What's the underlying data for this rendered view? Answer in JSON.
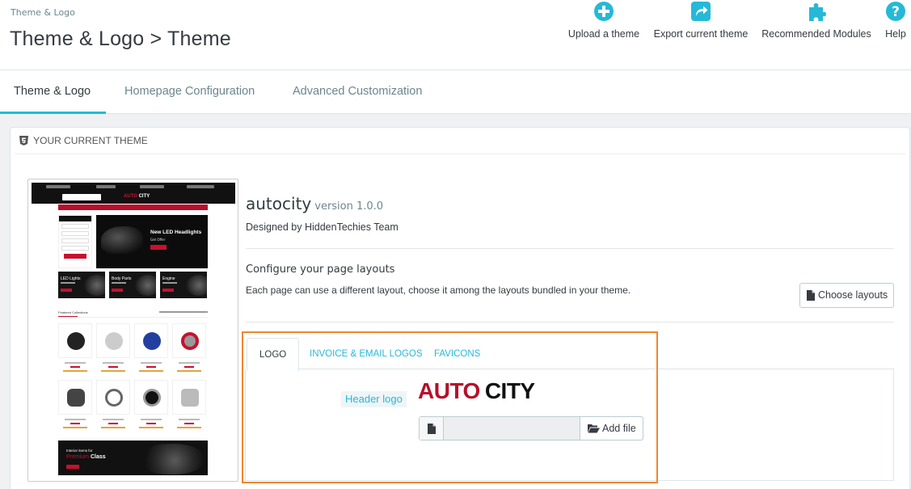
{
  "header": {
    "breadcrumb": "Theme & Logo",
    "title": "Theme & Logo > Theme",
    "toolbar": [
      {
        "label": "Upload a theme",
        "icon": "plus-circle-icon"
      },
      {
        "label": "Export current theme",
        "icon": "share-icon"
      },
      {
        "label": "Recommended Modules",
        "icon": "puzzle-icon"
      },
      {
        "label": "Help",
        "icon": "help-icon"
      }
    ]
  },
  "tabs": [
    {
      "label": "Theme & Logo",
      "active": true
    },
    {
      "label": "Homepage Configuration",
      "active": false
    },
    {
      "label": "Advanced Customization",
      "active": false
    }
  ],
  "panel": {
    "heading": "Your current theme",
    "preview": {
      "logo_a": "AUTO",
      "logo_b": "CITY",
      "banner_title": "New LED Headlights",
      "categories": [
        "LED Lights",
        "Body Parts",
        "Engine"
      ],
      "featured": "Featured Collections",
      "bottom_line1": "Interior items for",
      "bottom_line2a": "Premium",
      "bottom_line2b": "Class"
    },
    "theme": {
      "name": "autocity",
      "version": "version 1.0.0",
      "author": "Designed by HiddenTechies Team"
    },
    "layouts": {
      "title": "Configure your page layouts",
      "description": "Each page can use a different layout, choose it among the layouts bundled in your theme.",
      "button": "Choose layouts"
    },
    "logo_tabs": [
      {
        "label": "Logo",
        "active": true
      },
      {
        "label": "Invoice & Email Logos",
        "active": false
      },
      {
        "label": "Favicons",
        "active": false
      }
    ],
    "header_logo": {
      "label": "Header logo",
      "brand_a": "AUTO",
      "brand_b": "CITY",
      "file_value": "",
      "add_button": "Add file"
    }
  },
  "colors": {
    "accent": "#25b9d7",
    "brand_red": "#b5102a",
    "highlight": "#f0862e"
  }
}
